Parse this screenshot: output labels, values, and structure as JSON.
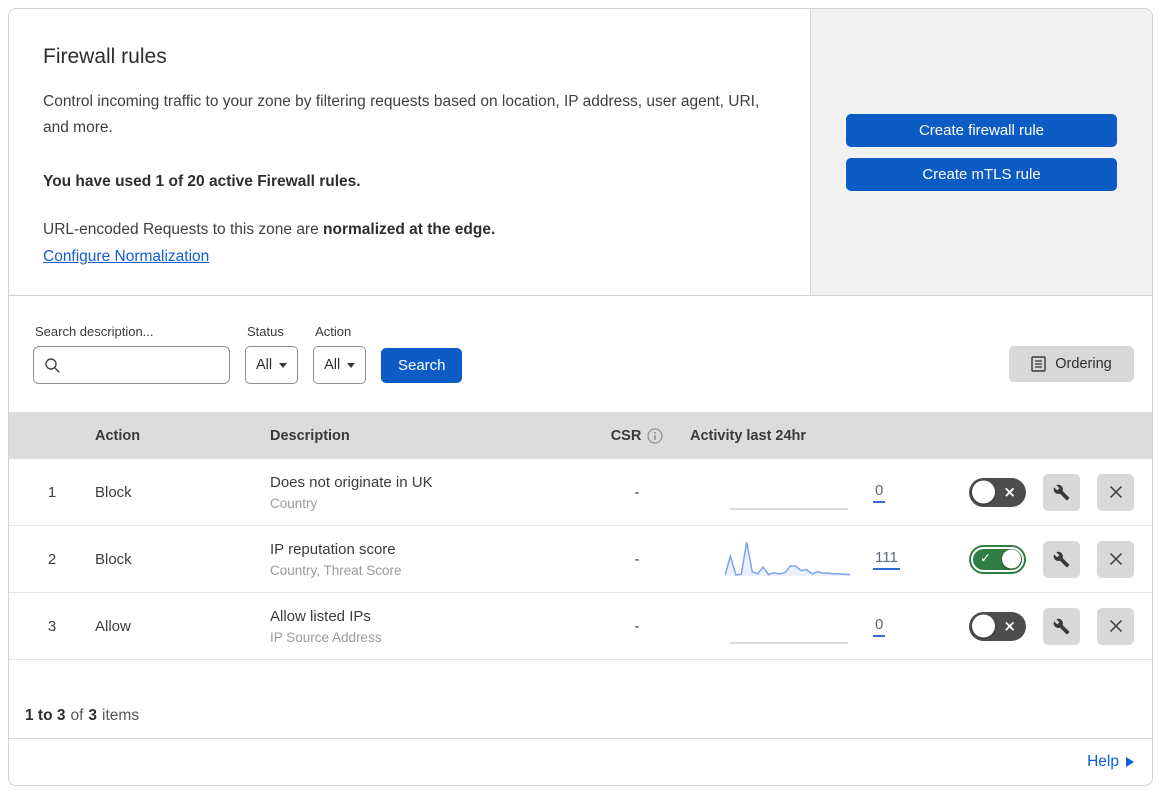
{
  "colors": {
    "accent_blue": "#0d5cc5",
    "link_blue": "#155bd4",
    "toggle_on_green": "#2f7d43",
    "toggle_off_grey": "#4d4d4d",
    "sparkline_blue": "#7ba3ea",
    "table_header_grey": "#dcdcdc",
    "side_panel_grey": "#f1f1f1"
  },
  "header": {
    "title": "Firewall rules",
    "description": "Control incoming traffic to your zone by filtering requests based on location, IP address, user agent, URI, and more.",
    "usage_notice": "You have used 1 of 20 active Firewall rules.",
    "normalization_prefix": "URL-encoded Requests to this zone are ",
    "normalization_bold": "normalized at the edge.",
    "configure_link": "Configure Normalization",
    "create_firewall_button": "Create firewall rule",
    "create_mtls_button": "Create mTLS rule"
  },
  "filters": {
    "search_label": "Search description...",
    "search_value": "",
    "status_label": "Status",
    "status_value": "All",
    "action_label": "Action",
    "action_value": "All",
    "search_button": "Search",
    "ordering_button": "Ordering"
  },
  "table": {
    "columns": {
      "action": "Action",
      "description": "Description",
      "csr": "CSR",
      "activity": "Activity last 24hr"
    },
    "rows": [
      {
        "priority": "1",
        "action": "Block",
        "description": "Does not originate in UK",
        "fields": "Country",
        "csr": "-",
        "activity_count": "0",
        "enabled": false,
        "sparkline": [
          0,
          0,
          0,
          0,
          0,
          0,
          0,
          0,
          0,
          0,
          0,
          0,
          0,
          0,
          0,
          0,
          0,
          0,
          0,
          0,
          0,
          0,
          0,
          0
        ]
      },
      {
        "priority": "2",
        "action": "Block",
        "description": "IP reputation score",
        "fields": "Country, Threat Score",
        "csr": "-",
        "activity_count": "111",
        "enabled": true,
        "sparkline": [
          3,
          55,
          3,
          5,
          95,
          12,
          6,
          25,
          4,
          9,
          6,
          9,
          28,
          28,
          15,
          18,
          6,
          12,
          8,
          8,
          6,
          6,
          5,
          4
        ]
      },
      {
        "priority": "3",
        "action": "Allow",
        "description": "Allow listed IPs",
        "fields": "IP Source Address",
        "csr": "-",
        "activity_count": "0",
        "enabled": false,
        "sparkline": [
          0,
          0,
          0,
          0,
          0,
          0,
          0,
          0,
          0,
          0,
          0,
          0,
          0,
          0,
          0,
          0,
          0,
          0,
          0,
          0,
          0,
          0,
          0,
          0
        ]
      }
    ]
  },
  "footer": {
    "range": "1 to 3",
    "of_label": "of",
    "total": "3",
    "items_label": "items",
    "help_label": "Help"
  }
}
